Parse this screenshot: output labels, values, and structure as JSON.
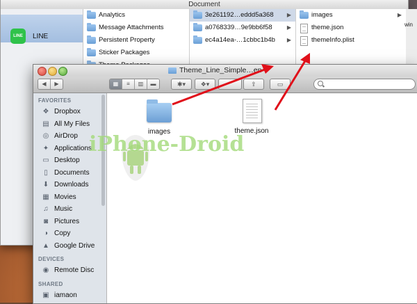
{
  "background_window": {
    "title": "Document",
    "sidebar_selected_app": {
      "label": "LINE",
      "icon": "line-app-icon",
      "icon_text": "LINE"
    },
    "column1": [
      {
        "label": "Analytics",
        "icon": "folder-icon"
      },
      {
        "label": "Message Attachments",
        "icon": "folder-icon"
      },
      {
        "label": "Persistent Property",
        "icon": "folder-icon"
      },
      {
        "label": "Sticker Packages",
        "icon": "folder-icon"
      },
      {
        "label": "Theme Packages",
        "icon": "folder-icon"
      }
    ],
    "column2": [
      {
        "label": "3e261192…eddd5a368",
        "icon": "folder-icon",
        "selected": true
      },
      {
        "label": "a0768339…9e9bb6f58",
        "icon": "folder-icon"
      },
      {
        "label": "ec4a14ea-…1cbbc1b4b",
        "icon": "folder-icon"
      }
    ],
    "column3": [
      {
        "label": "images",
        "icon": "folder-icon"
      },
      {
        "label": "theme.json",
        "icon": "document-icon"
      },
      {
        "label": "themeInfo.plist",
        "icon": "document-icon"
      }
    ],
    "right_edge_text": "win"
  },
  "front_window": {
    "title": "Theme_Line_Simple…en",
    "toolbar": {
      "back": "◀",
      "forward": "▶",
      "view_modes": [
        "icon-view",
        "list-view",
        "column-view",
        "coverflow-view"
      ],
      "action_button": "gear-icon",
      "dropbox_button": "dropbox-icon",
      "share_button": "share-icon",
      "tag_button": "tag-icon",
      "search_placeholder": ""
    },
    "sidebar": {
      "sections": [
        {
          "heading": "FAVORITES",
          "items": [
            {
              "label": "Dropbox",
              "icon": "dropbox-icon",
              "glyph": "❖"
            },
            {
              "label": "All My Files",
              "icon": "all-files-icon",
              "glyph": "▤"
            },
            {
              "label": "AirDrop",
              "icon": "airdrop-icon",
              "glyph": "◎"
            },
            {
              "label": "Applications",
              "icon": "applications-icon",
              "glyph": "✦"
            },
            {
              "label": "Desktop",
              "icon": "desktop-icon",
              "glyph": "▭"
            },
            {
              "label": "Documents",
              "icon": "documents-icon",
              "glyph": "▯"
            },
            {
              "label": "Downloads",
              "icon": "downloads-icon",
              "glyph": "⬇"
            },
            {
              "label": "Movies",
              "icon": "movies-icon",
              "glyph": "▦"
            },
            {
              "label": "Music",
              "icon": "music-icon",
              "glyph": "♫"
            },
            {
              "label": "Pictures",
              "icon": "pictures-icon",
              "glyph": "◙"
            },
            {
              "label": "Copy",
              "icon": "copy-icon",
              "glyph": "◑"
            },
            {
              "label": "Google Drive",
              "icon": "google-drive-icon",
              "glyph": "▲"
            }
          ]
        },
        {
          "heading": "DEVICES",
          "items": [
            {
              "label": "Remote Disc",
              "icon": "remote-disc-icon",
              "glyph": "◉"
            }
          ]
        },
        {
          "heading": "SHARED",
          "items": [
            {
              "label": "iamaon",
              "icon": "shared-computer-icon",
              "glyph": "▣"
            }
          ]
        }
      ]
    },
    "content_items": [
      {
        "label": "images",
        "icon": "folder-icon"
      },
      {
        "label": "theme.json",
        "icon": "document-icon"
      }
    ]
  },
  "watermark": {
    "text": "iPhone-Droid",
    "icon": "android-apple-logo"
  },
  "annotation_arrow_color": "#e0101a"
}
